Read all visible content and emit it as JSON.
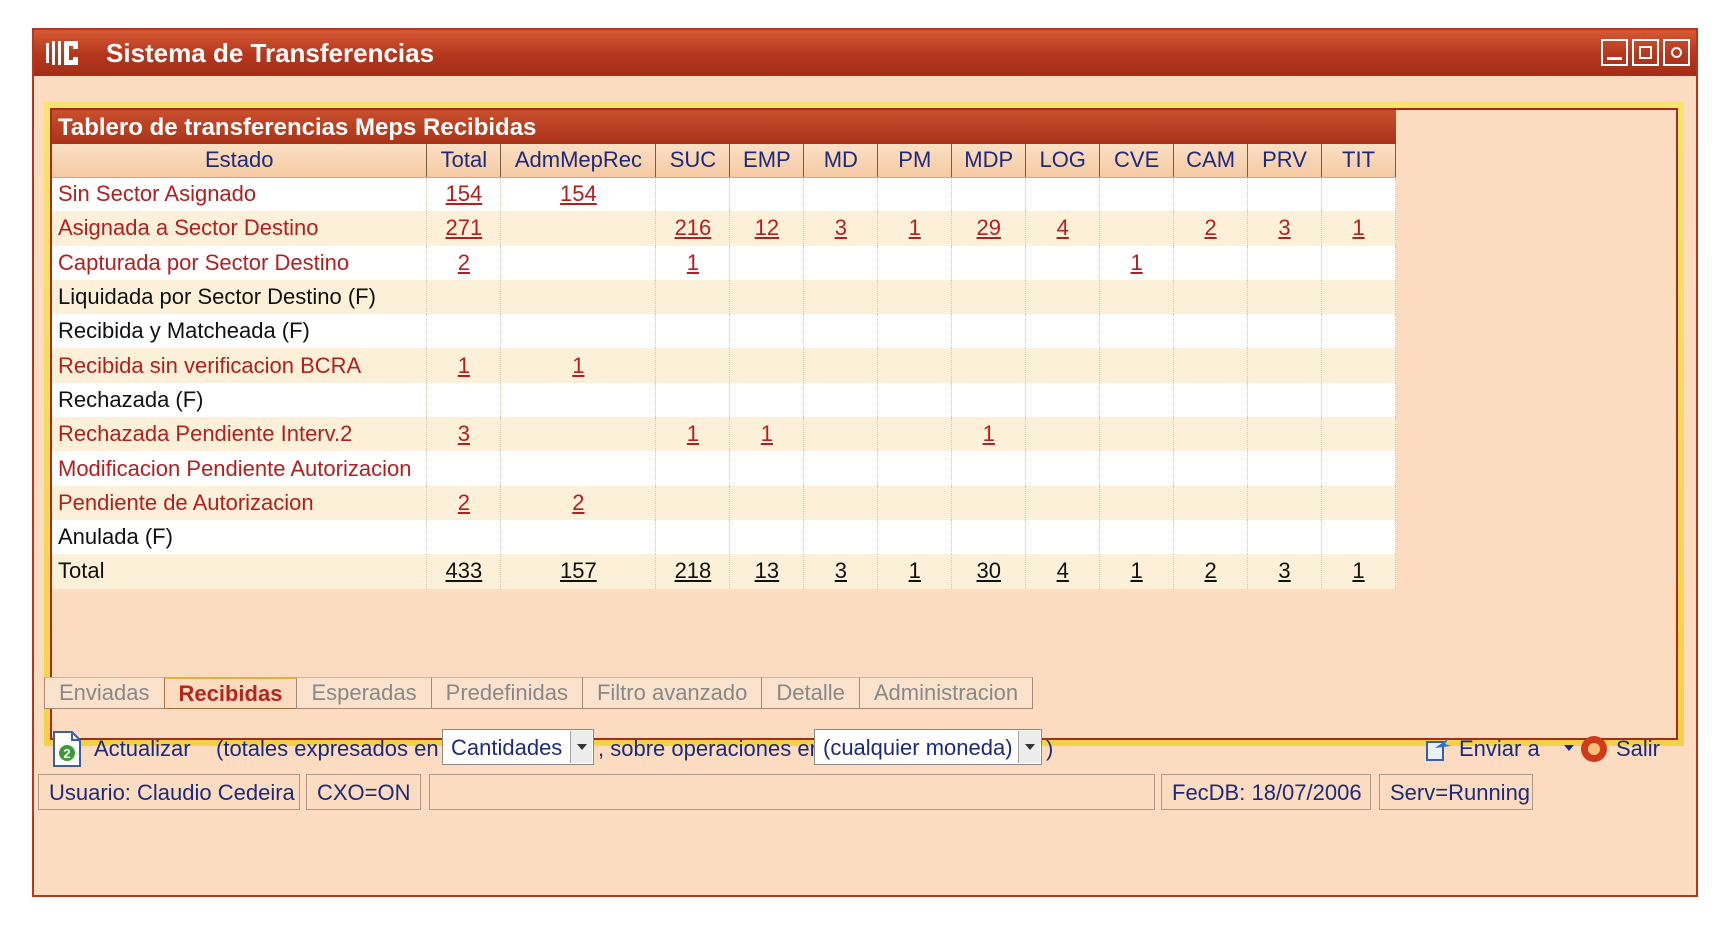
{
  "app": {
    "title": "Sistema de Transferencias"
  },
  "panel": {
    "title": "Tablero de transferencias Meps Recibidas"
  },
  "table": {
    "columns": [
      "Estado",
      "Total",
      "AdmMepRec",
      "SUC",
      "EMP",
      "MD",
      "PM",
      "MDP",
      "LOG",
      "CVE",
      "CAM",
      "PRV",
      "TIT"
    ],
    "rows": [
      {
        "label": "Sin Sector Asignado",
        "link": true,
        "values": [
          "154",
          "154",
          "",
          "",
          "",
          "",
          "",
          "",
          "",
          "",
          "",
          ""
        ]
      },
      {
        "label": "Asignada a Sector Destino",
        "link": true,
        "values": [
          "271",
          "",
          "216",
          "12",
          "3",
          "1",
          "29",
          "4",
          "",
          "2",
          "3",
          "1"
        ]
      },
      {
        "label": "Capturada por Sector Destino",
        "link": true,
        "values": [
          "2",
          "",
          "1",
          "",
          "",
          "",
          "",
          "",
          "1",
          "",
          "",
          ""
        ]
      },
      {
        "label": "Liquidada por Sector Destino (F)",
        "link": false,
        "values": [
          "",
          "",
          "",
          "",
          "",
          "",
          "",
          "",
          "",
          "",
          "",
          ""
        ]
      },
      {
        "label": "Recibida y Matcheada (F)",
        "link": false,
        "values": [
          "",
          "",
          "",
          "",
          "",
          "",
          "",
          "",
          "",
          "",
          "",
          ""
        ]
      },
      {
        "label": "Recibida sin verificacion BCRA",
        "link": true,
        "values": [
          "1",
          "1",
          "",
          "",
          "",
          "",
          "",
          "",
          "",
          "",
          "",
          ""
        ]
      },
      {
        "label": "Rechazada (F)",
        "link": false,
        "values": [
          "",
          "",
          "",
          "",
          "",
          "",
          "",
          "",
          "",
          "",
          "",
          ""
        ]
      },
      {
        "label": "Rechazada Pendiente Interv.2",
        "link": true,
        "values": [
          "3",
          "",
          "1",
          "1",
          "",
          "",
          "1",
          "",
          "",
          "",
          "",
          ""
        ]
      },
      {
        "label": "Modificacion Pendiente Autorizacion",
        "link": true,
        "values": [
          "",
          "",
          "",
          "",
          "",
          "",
          "",
          "",
          "",
          "",
          "",
          ""
        ]
      },
      {
        "label": "Pendiente de Autorizacion",
        "link": true,
        "values": [
          "2",
          "2",
          "",
          "",
          "",
          "",
          "",
          "",
          "",
          "",
          "",
          ""
        ]
      },
      {
        "label": "Anulada (F)",
        "link": false,
        "values": [
          "",
          "",
          "",
          "",
          "",
          "",
          "",
          "",
          "",
          "",
          "",
          ""
        ]
      },
      {
        "label": "Total",
        "link": false,
        "total": true,
        "values": [
          "433",
          "157",
          "218",
          "13",
          "3",
          "1",
          "30",
          "4",
          "1",
          "2",
          "3",
          "1"
        ]
      }
    ]
  },
  "tabs": [
    "Enviadas",
    "Recibidas",
    "Esperadas",
    "Predefinidas",
    "Filtro avanzado",
    "Detalle",
    "Administracion"
  ],
  "active_tab": "Recibidas",
  "toolbar": {
    "refresh_label": "Actualizar",
    "text1": "(totales expresados en",
    "combo1": "Cantidades",
    "text2": ", sobre operaciones en",
    "combo2": "(cualquier moneda)",
    "text3": ")",
    "send_label": "Enviar a",
    "exit_label": "Salir"
  },
  "status": {
    "user": "Usuario: Claudio Cedeira",
    "cxo": "CXO=ON",
    "message": "",
    "fecdb": "FecDB: 18/07/2006",
    "serv": "Serv=Running"
  },
  "colors": {
    "titlebar": "#b4361d",
    "background": "#fcdcc0",
    "frame": "#f3d24a",
    "link": "#b21f1f",
    "header_text": "#1b2a7a"
  }
}
